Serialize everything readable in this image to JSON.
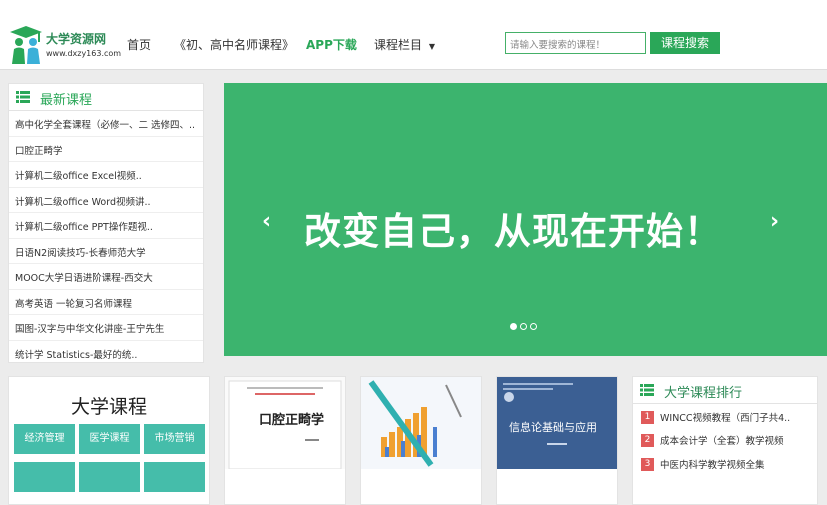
{
  "header": {
    "logo_title": "大学资源网",
    "logo_url": "www.dxzy163.com",
    "nav": [
      {
        "label": "首页"
      },
      {
        "label": "《初、高中名师课程》"
      },
      {
        "label": "APP下载"
      },
      {
        "label": "课程栏目"
      }
    ],
    "search": {
      "placeholder": "请输入要搜索的课程！",
      "button_label": "课程搜索"
    },
    "accent_color": "#2aa758"
  },
  "latest": {
    "title": "最新课程",
    "items": [
      {
        "label": "高中化学全套课程（必修一、二 选修四、.."
      },
      {
        "label": "口腔正畸学"
      },
      {
        "label": "计算机二级office Excel视频.."
      },
      {
        "label": "计算机二级office Word视频讲.."
      },
      {
        "label": "计算机二级office PPT操作题视.."
      },
      {
        "label": "日语N2阅读技巧-长春师范大学"
      },
      {
        "label": "MOOC大学日语进阶课程-西交大"
      },
      {
        "label": "高考英语 一轮复习名师课程"
      },
      {
        "label": "国图-汉字与中华文化讲座-王宁先生"
      },
      {
        "label": "统计学 Statistics-最好的统.."
      }
    ]
  },
  "banner": {
    "text": "改变自己，从现在开始！",
    "prev_arrow": "‹",
    "next_arrow": "›",
    "slide_count": 3,
    "active_slide": 1,
    "background_color": "#3cb46e"
  },
  "university": {
    "title": "大学课程",
    "categories": [
      {
        "label": "经济管理"
      },
      {
        "label": "医学课程"
      },
      {
        "label": "市场营销"
      },
      {
        "label": ""
      },
      {
        "label": ""
      },
      {
        "label": ""
      }
    ]
  },
  "cards": [
    {
      "cover_title": "口腔正畸学"
    },
    {
      "cover_title": ""
    },
    {
      "cover_title": "信息论基础与应用"
    }
  ],
  "ranking": {
    "title": "大学课程排行",
    "items": [
      {
        "rank": "1",
        "label": "WINCC视频教程（西门子共4.."
      },
      {
        "rank": "2",
        "label": "成本会计学（全套）教学视频"
      },
      {
        "rank": "3",
        "label": "中医内科学教学视频全集"
      }
    ]
  }
}
